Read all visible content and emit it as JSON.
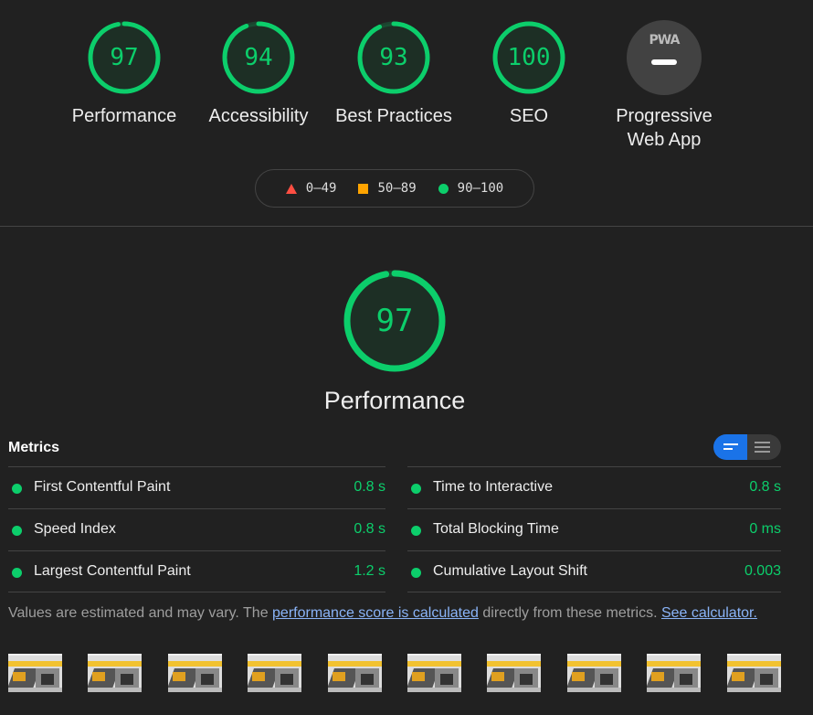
{
  "categories": [
    {
      "label": "Performance",
      "score": "97",
      "value": 97
    },
    {
      "label": "Accessibility",
      "score": "94",
      "value": 94
    },
    {
      "label": "Best Practices",
      "score": "93",
      "value": 93
    },
    {
      "label": "SEO",
      "score": "100",
      "value": 100
    }
  ],
  "pwa": {
    "badge": "PWA",
    "label_line1": "Progressive",
    "label_line2": "Web App"
  },
  "legend": {
    "fail": "0–49",
    "average": "50–89",
    "pass": "90–100"
  },
  "colors": {
    "pass": "#0cce6b",
    "average": "#ffa400",
    "fail": "#ff4e42",
    "link": "#8ab4f8",
    "toggle_active": "#1a73e8"
  },
  "main": {
    "score": "97",
    "value": 97,
    "label": "Performance"
  },
  "metrics": {
    "title": "Metrics",
    "left": [
      {
        "name": "First Contentful Paint",
        "value": "0.8 s"
      },
      {
        "name": "Speed Index",
        "value": "0.8 s"
      },
      {
        "name": "Largest Contentful Paint",
        "value": "1.2 s"
      }
    ],
    "right": [
      {
        "name": "Time to Interactive",
        "value": "0.8 s"
      },
      {
        "name": "Total Blocking Time",
        "value": "0 ms"
      },
      {
        "name": "Cumulative Layout Shift",
        "value": "0.003"
      }
    ]
  },
  "note": {
    "text1": "Values are estimated and may vary. The ",
    "link1": "performance score is calculated",
    "text2": " directly from these metrics. ",
    "link2": "See calculator."
  },
  "filmstrip_count": 10
}
